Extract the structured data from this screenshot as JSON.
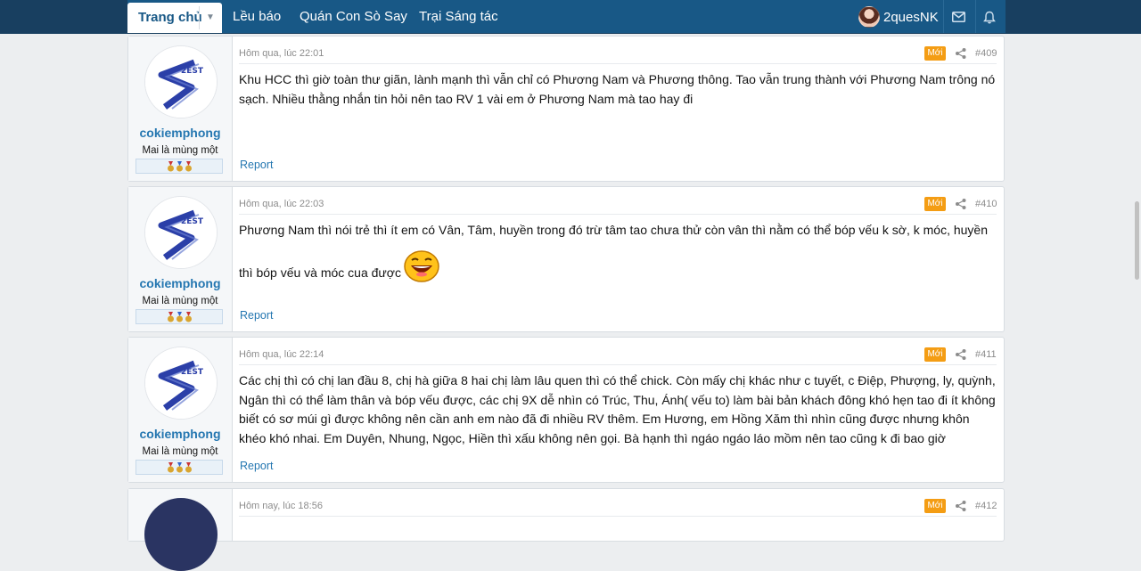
{
  "nav": {
    "home": "Trang chủ",
    "items": [
      "Lều báo",
      "Quán Con Sò Say",
      "Trại Sáng tác"
    ],
    "username": "2quesNK",
    "icons": [
      "inbox-icon",
      "bell-icon"
    ]
  },
  "posts": [
    {
      "username": "cokiemphong",
      "title": "Mai là mùng một",
      "time": "Hôm qua, lúc 22:01",
      "badge": "Mới",
      "num": "#409",
      "content": "Khu HCC thì giờ toàn thư giãn, lành mạnh thì vẫn chỉ có Phương Nam và Phương thông. Tao vẫn trung thành với Phương Nam trông nó sạch. Nhiều thằng nhắn tin hỏi nên tao RV 1 vài em ở Phương Nam mà tao hay đi",
      "report": "Report"
    },
    {
      "username": "cokiemphong",
      "title": "Mai là mùng một",
      "time": "Hôm qua, lúc 22:03",
      "badge": "Mới",
      "num": "#410",
      "content_line1": "Phương Nam thì nói trẻ thì ít em có Vân, Tâm, huyền trong đó trừ tâm tao chưa thử còn vân thì nằm có thể bóp vếu k sờ, k móc, huyền",
      "content_line2": "thì bóp vếu và móc cua được",
      "report": "Report"
    },
    {
      "username": "cokiemphong",
      "title": "Mai là mùng một",
      "time": "Hôm qua, lúc 22:14",
      "badge": "Mới",
      "num": "#411",
      "content": "Các chị thì có chị lan đầu 8, chị hà giữa 8 hai chị làm lâu quen thì có thể chick. Còn mấy chị khác như c tuyết, c Điệp, Phượng, ly, quỳnh, Ngân thì có thể làm thân và bóp vếu được, các chị 9X dễ nhìn có Trúc, Thu, Ánh( vếu to) làm bài bản khách đông khó hẹn tao đi ít không biết có sơ múi gì được không nên cần anh em nào đã đi nhiều RV thêm. Em Hương, em Hồng Xăm thì nhìn cũng được nhưng khôn khéo khó nhai. Em Duyên, Nhung, Ngọc, Hiền thì xấu không nên gọi. Bà hạnh thì ngáo ngáo láo mồm nên tao cũng k đi bao giờ",
      "report": "Report"
    },
    {
      "time": "Hôm nay, lúc 18:56",
      "badge": "Mới",
      "num": "#412"
    }
  ],
  "colors": {
    "nav_bg": "#185886",
    "link": "#2577b1",
    "new_badge": "#f49d14"
  }
}
